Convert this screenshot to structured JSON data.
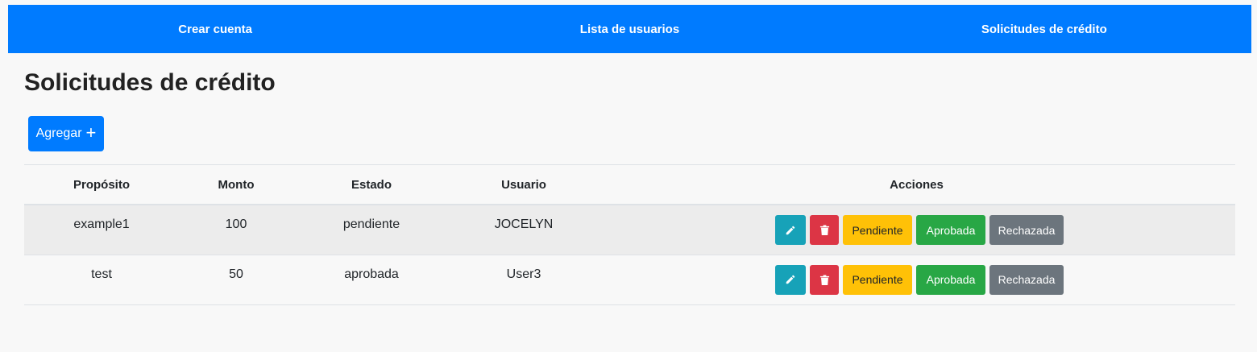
{
  "nav": {
    "items": [
      {
        "label": "Crear cuenta"
      },
      {
        "label": "Lista de usuarios"
      },
      {
        "label": "Solicitudes de crédito"
      }
    ]
  },
  "page": {
    "title": "Solicitudes de crédito",
    "add_label": "Agregar",
    "add_icon": "plus-icon"
  },
  "table": {
    "headers": {
      "proposito": "Propósito",
      "monto": "Monto",
      "estado": "Estado",
      "usuario": "Usuario",
      "acciones": "Acciones"
    },
    "rows": [
      {
        "proposito": "example1",
        "monto": "100",
        "estado": "pendiente",
        "usuario": "JOCELYN"
      },
      {
        "proposito": "test",
        "monto": "50",
        "estado": "aprobada",
        "usuario": "User3"
      }
    ],
    "actions": {
      "edit_icon": "pencil-icon",
      "delete_icon": "trash-icon",
      "pendiente": "Pendiente",
      "aprobada": "Aprobada",
      "rechazada": "Rechazada"
    }
  },
  "colors": {
    "primary": "#007bff",
    "info": "#17a2b8",
    "danger": "#dc3545",
    "warning": "#ffc107",
    "success": "#28a745",
    "secondary": "#6c757d"
  }
}
